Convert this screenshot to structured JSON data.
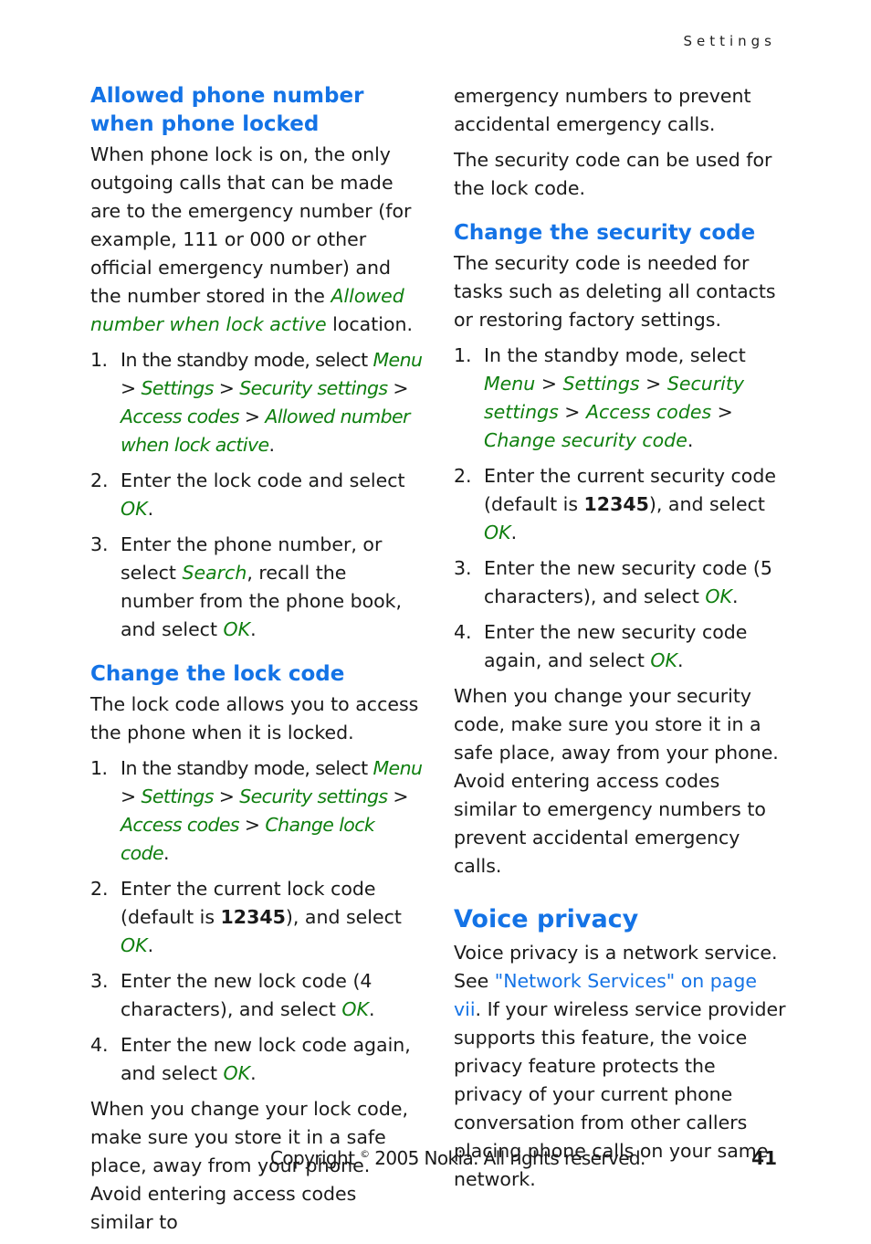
{
  "running_head": "Settings",
  "colors": {
    "heading": "#1473e6",
    "ui_term": "#0f7f0f",
    "link": "#1473e6",
    "text": "#1a1a1a"
  },
  "left": {
    "s1": {
      "title": "Allowed phone number when phone locked",
      "intro": [
        "When phone lock is on, the only outgoing calls that can be made are to the emergency number (for example, 111 or 000 or other official emergency number) and the number stored in the ",
        "Allowed number when lock active",
        " location."
      ],
      "steps": [
        {
          "num": "1.",
          "parts": [
            "In the standby mode, select ",
            "Menu",
            " > ",
            "Settings",
            " > ",
            "Security settings",
            " > ",
            "Access codes",
            " > ",
            "Allowed number when lock active",
            "."
          ]
        },
        {
          "num": "2.",
          "parts": [
            "Enter the lock code and select ",
            "OK",
            "."
          ]
        },
        {
          "num": "3.",
          "parts": [
            "Enter the phone number, or select ",
            "Search",
            ", recall the number from the phone book, and select ",
            "OK",
            "."
          ]
        }
      ]
    },
    "s2": {
      "title": "Change the lock code",
      "intro": "The lock code allows you to access the phone when it is locked.",
      "steps": [
        {
          "num": "1.",
          "parts": [
            "In the standby mode, select ",
            "Menu",
            " > ",
            "Settings",
            " > ",
            "Security settings",
            " > ",
            "Access codes",
            " > ",
            "Change lock code",
            "."
          ]
        },
        {
          "num": "2.",
          "parts": [
            "Enter the current lock code (default is ",
            "12345",
            "), and select ",
            "OK",
            "."
          ]
        },
        {
          "num": "3.",
          "parts": [
            "Enter the new lock code (4 characters), and select ",
            "OK",
            "."
          ]
        },
        {
          "num": "4.",
          "parts": [
            "Enter the new lock code again, and select ",
            "OK",
            "."
          ]
        }
      ],
      "note": "When you change your lock code, make sure you store it in a safe place, away from your phone. Avoid entering access codes similar to"
    }
  },
  "right": {
    "continued": "emergency numbers to prevent accidental emergency calls.",
    "security_note": "The security code can be used for the lock code.",
    "s3": {
      "title": "Change the security code",
      "intro": "The security code is needed for tasks such as deleting all contacts or restoring factory settings.",
      "steps": [
        {
          "num": "1.",
          "parts": [
            "In the standby mode, select ",
            "Menu",
            " > ",
            "Settings",
            " > ",
            "Security settings",
            " > ",
            "Access codes",
            " > ",
            "Change security code",
            "."
          ]
        },
        {
          "num": "2.",
          "parts": [
            "Enter the current security code (default is ",
            "12345",
            "), and select ",
            "OK",
            "."
          ]
        },
        {
          "num": "3.",
          "parts": [
            "Enter the new security code (5 characters), and select ",
            "OK",
            "."
          ]
        },
        {
          "num": "4.",
          "parts": [
            "Enter the new security code again, and select ",
            "OK",
            "."
          ]
        }
      ],
      "note": "When you change your security code, make sure you store it in a safe place, away from your phone. Avoid entering access codes similar to emergency numbers to prevent accidental emergency calls."
    },
    "s4": {
      "title": "Voice privacy",
      "body_a": "Voice privacy is a network service. See ",
      "link": "\"Network Services\" on page vii",
      "body_b": ". If your wireless service provider supports this feature, the voice privacy feature protects the privacy of your current phone conversation from other callers placing phone calls on your same network."
    }
  },
  "footer": {
    "copyright_pre": "Copyright ",
    "copyright_symbol": "©",
    "copyright_post": " 2005 Nokia. All rights reserved.",
    "page_number": "41"
  }
}
